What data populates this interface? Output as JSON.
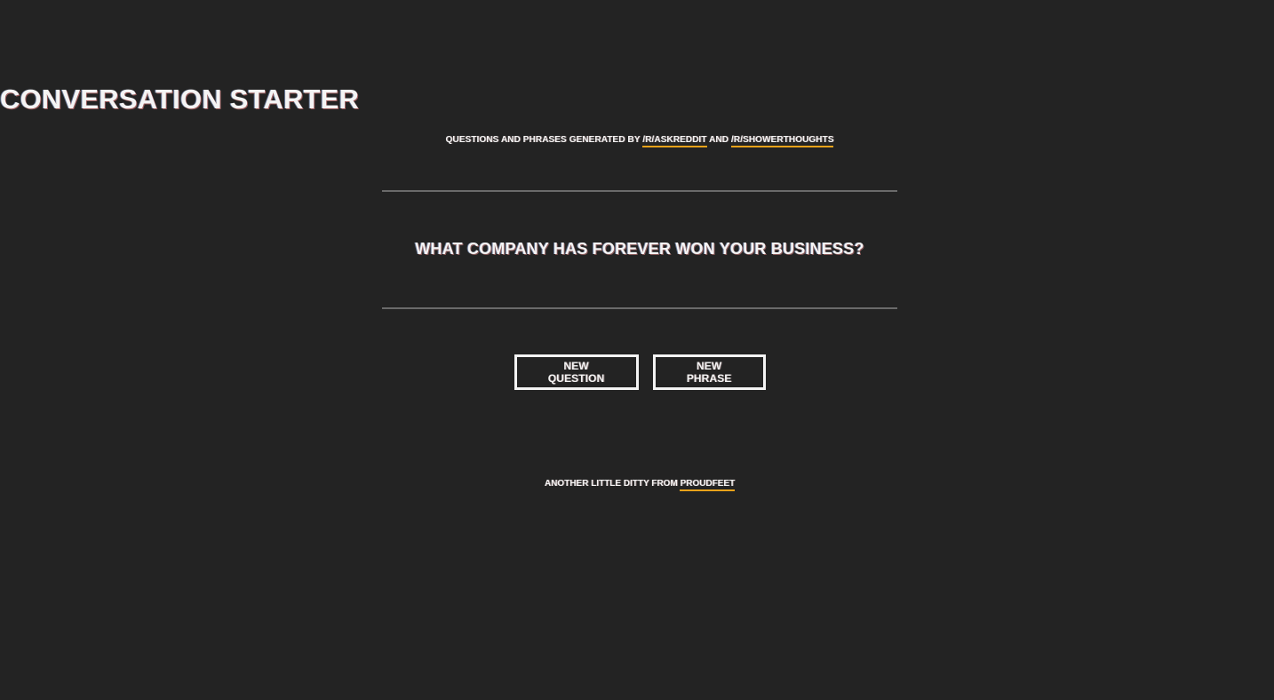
{
  "header": {
    "title": "CONVERSATION STARTER",
    "subtitle_prefix": "QUESTIONS AND PHRASES GENERATED BY ",
    "link_askreddit": "/R/ASKREDDIT",
    "subtitle_and": " AND ",
    "link_showerthoughts": "/R/SHOWERTHOUGHTS"
  },
  "main": {
    "question": "WHAT COMPANY HAS FOREVER WON YOUR BUSINESS?"
  },
  "buttons": {
    "new_question": "NEW QUESTION",
    "new_phrase": "NEW PHRASE"
  },
  "footer": {
    "prefix": "ANOTHER LITTLE DITTY FROM ",
    "link_proudfeet": "PROUDFEET"
  },
  "colors": {
    "background": "#232323",
    "text": "#f4f4f4",
    "accent_underline": "#e8a21a",
    "rule": "#6a6a6a"
  }
}
